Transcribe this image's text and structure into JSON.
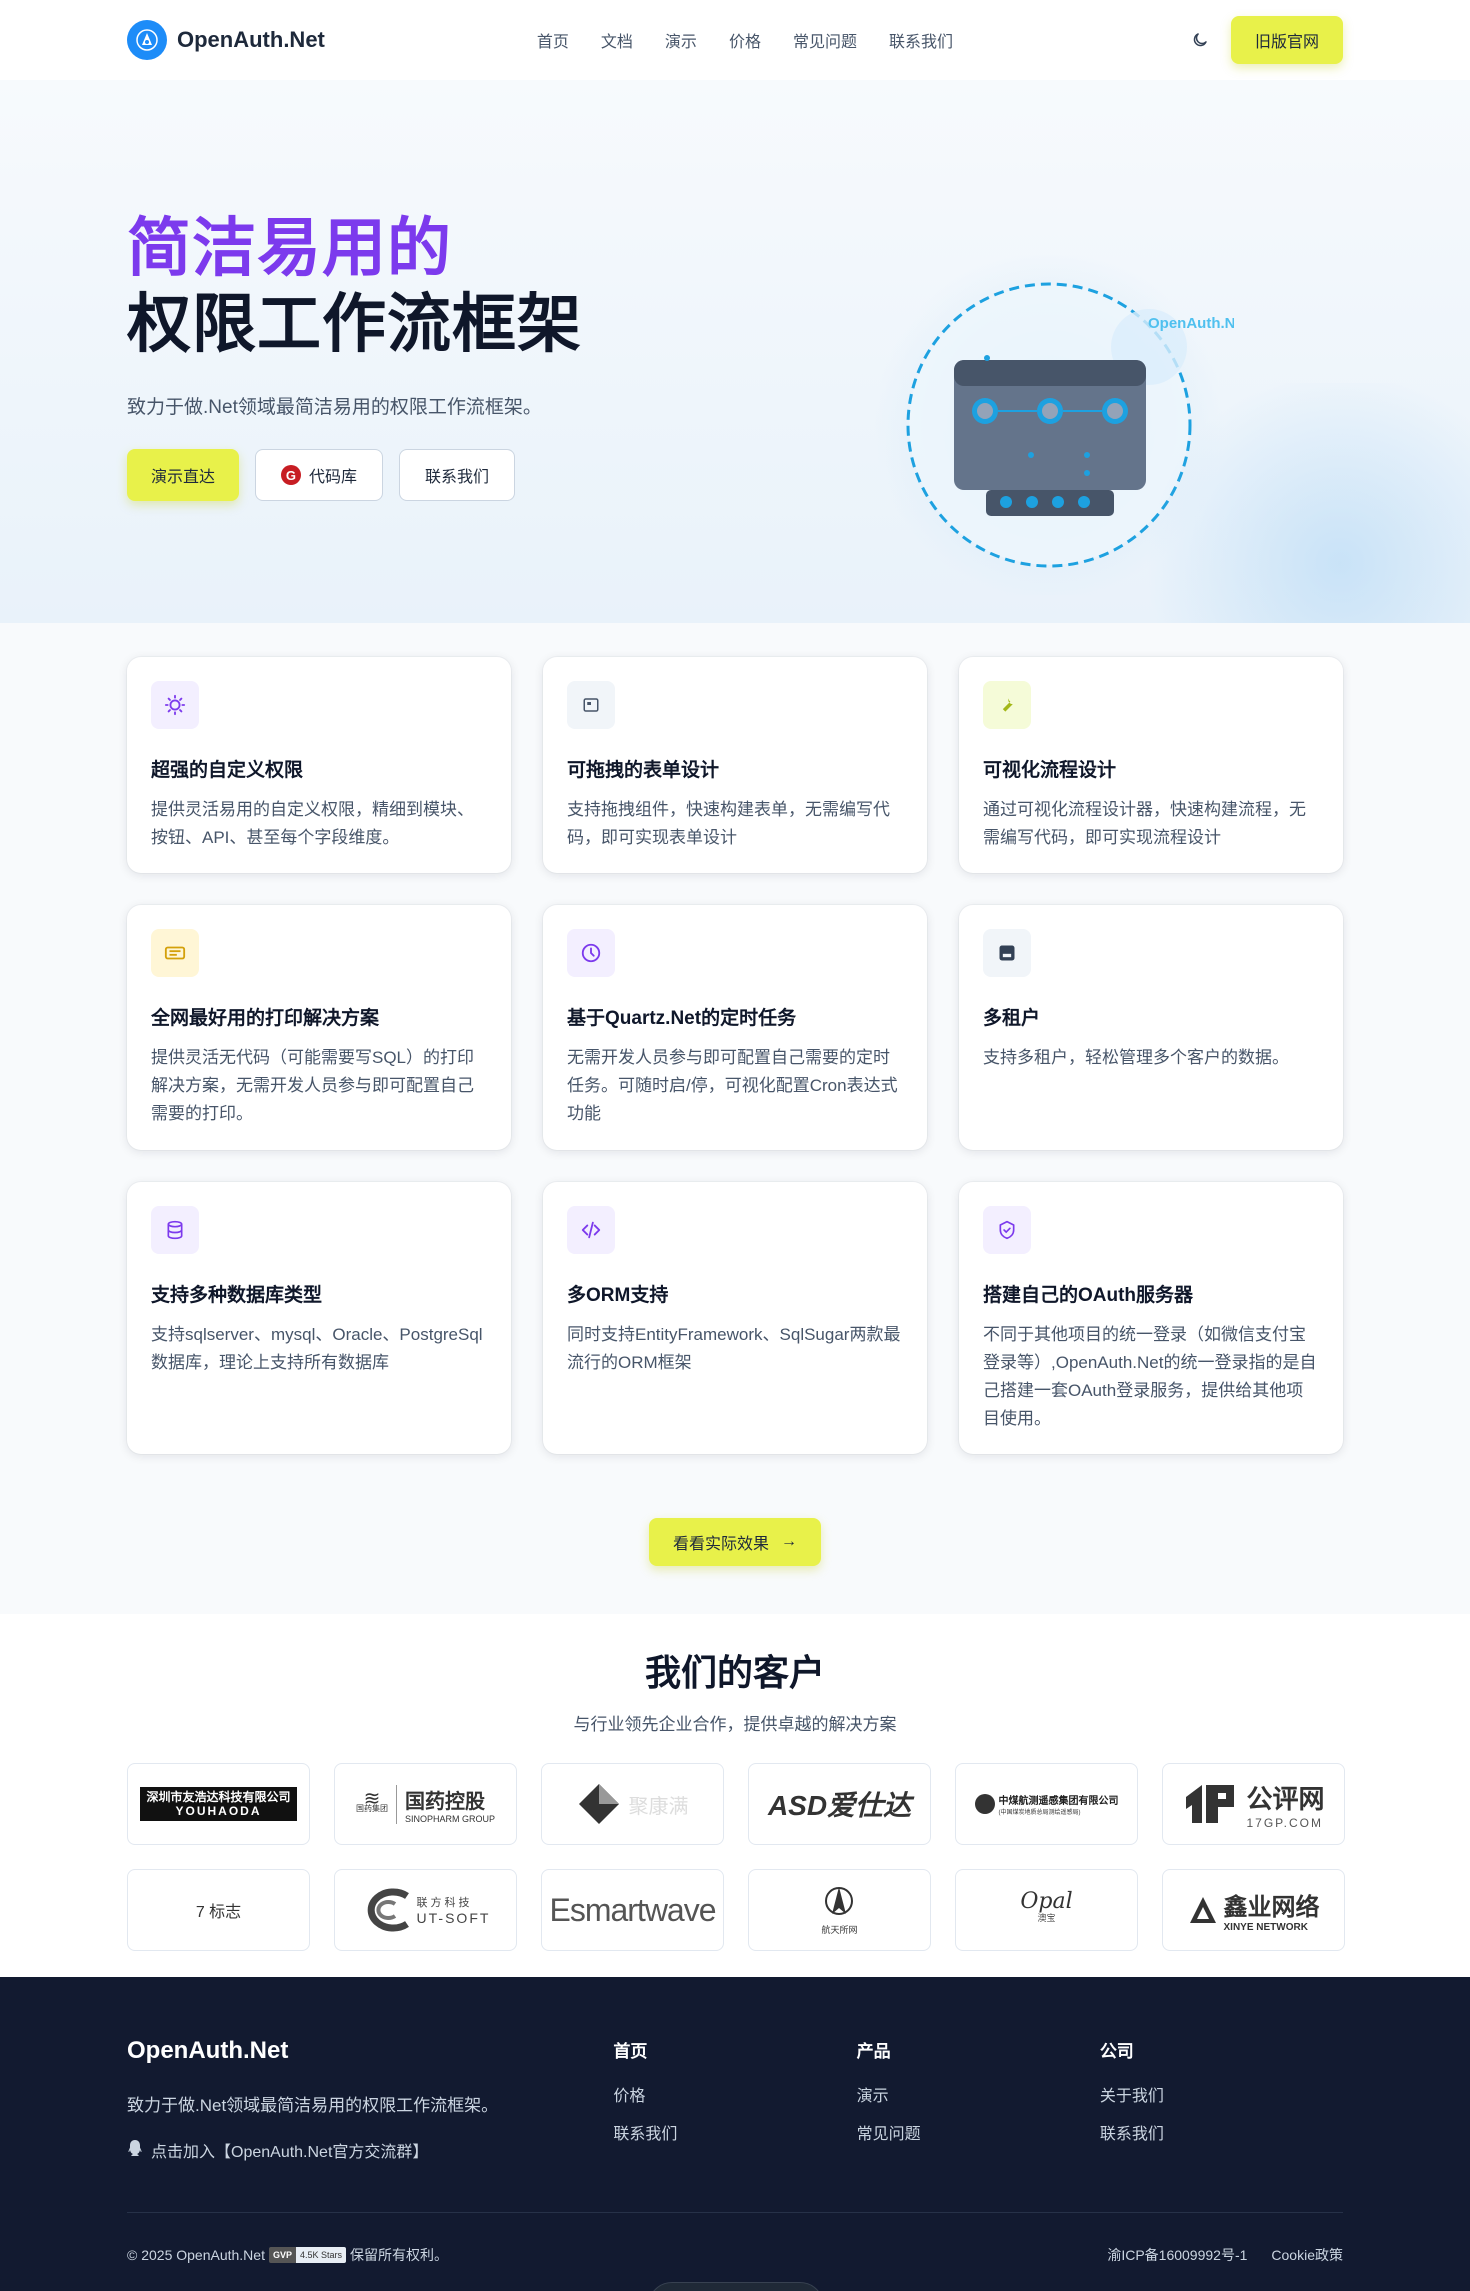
{
  "nav": {
    "brand": "OpenAuth.Net",
    "links": [
      "首页",
      "文档",
      "演示",
      "价格",
      "常见问题",
      "联系我们"
    ],
    "old_site": "旧版官网"
  },
  "hero": {
    "title_highlight": "简洁易用的",
    "title_main": "权限工作流框架",
    "subtitle": "致力于做.Net领域最简洁易用的权限工作流框架。",
    "btn_demo": "演示直达",
    "btn_code": "代码库",
    "btn_contact": "联系我们",
    "art_label": "OpenAuth.Net"
  },
  "features": [
    {
      "icon": "sun-icon",
      "icon_bg": "#f3efff",
      "icon_color": "#7c3aed",
      "title": "超强的自定义权限",
      "desc": "提供灵活易用的自定义权限，精细到模块、按钮、API、甚至每个字段维度。"
    },
    {
      "icon": "form-icon",
      "icon_bg": "#f1f5f9",
      "icon_color": "#475569",
      "title": "可拖拽的表单设计",
      "desc": "支持拖拽组件，快速构建表单，无需编写代码，即可实现表单设计"
    },
    {
      "icon": "wrench-icon",
      "icon_bg": "#f5fbd8",
      "icon_color": "#a3b818",
      "title": "可视化流程设计",
      "desc": "通过可视化流程设计器，快速构建流程，无需编写代码，即可实现流程设计"
    },
    {
      "icon": "ticket-icon",
      "icon_bg": "#fff6d6",
      "icon_color": "#d4a00a",
      "title": "全网最好用的打印解决方案",
      "desc": "提供灵活无代码（可能需要写SQL）的打印解决方案，无需开发人员参与即可配置自己需要的打印。"
    },
    {
      "icon": "clock-icon",
      "icon_bg": "#f3efff",
      "icon_color": "#7c3aed",
      "title": "基于Quartz.Net的定时任务",
      "desc": "无需开发人员参与即可配置自己需要的定时任务。可随时启/停，可视化配置Cron表达式功能"
    },
    {
      "icon": "tenant-icon",
      "icon_bg": "#f1f5f9",
      "icon_color": "#334155",
      "title": "多租户",
      "desc": "支持多租户，轻松管理多个客户的数据。"
    },
    {
      "icon": "database-icon",
      "icon_bg": "#f3efff",
      "icon_color": "#7c3aed",
      "title": "支持多种数据库类型",
      "desc": "支持sqlserver、mysql、Oracle、PostgreSql数据库，理论上支持所有数据库"
    },
    {
      "icon": "code-icon",
      "icon_bg": "#f3efff",
      "icon_color": "#7c3aed",
      "title": "多ORM支持",
      "desc": "同时支持EntityFramework、SqlSugar两款最流行的ORM框架"
    },
    {
      "icon": "shield-check-icon",
      "icon_bg": "#f3efff",
      "icon_color": "#7c3aed",
      "title": "搭建自己的OAuth服务器",
      "desc": "不同于其他项目的统一登录（如微信支付宝登录等）,OpenAuth.Net的统一登录指的是自己搭建一套OAuth登录服务，提供给其他项目使用。"
    }
  ],
  "cta": {
    "label": "看看实际效果",
    "arrow": "→"
  },
  "customers": {
    "title": "我们的客户",
    "subtitle": "与行业领先企业合作，提供卓越的解决方案",
    "logos": [
      {
        "name": "youhaoda",
        "text": "深圳市友浩达科技有限公司",
        "sub": "YOUHAODA"
      },
      {
        "name": "sinopharm",
        "text": "国药控股",
        "sub": "SINOPHARM GROUP",
        "tag": "国药集团"
      },
      {
        "name": "wave",
        "text": "聚康满"
      },
      {
        "name": "asd",
        "text": "ASD爱仕达"
      },
      {
        "name": "coal",
        "text": "中煤航测遥感集团有限公司",
        "sub": "(中国煤炭地质总局测绘遥感局)"
      },
      {
        "name": "17gp",
        "text": "公评网",
        "sub": "17GP.COM"
      },
      {
        "name": "broken",
        "text": "7 标志"
      },
      {
        "name": "utsoft",
        "text": "联方科技",
        "sub": "UT-SOFT"
      },
      {
        "name": "esmartwave",
        "text": "Esmartwave"
      },
      {
        "name": "hangtian",
        "text": "航天所网"
      },
      {
        "name": "opal",
        "text": "Opal",
        "sub": "澳宝"
      },
      {
        "name": "xinye",
        "text": "鑫业网络",
        "sub": "XINYE NETWORK"
      }
    ]
  },
  "footer": {
    "brand": "OpenAuth.Net",
    "desc": "致力于做.Net领域最简洁易用的权限工作流框架。",
    "qq": "点击加入【OpenAuth.Net官方交流群】",
    "cols": [
      {
        "title": "首页",
        "links": [
          "价格",
          "联系我们"
        ]
      },
      {
        "title": "产品",
        "links": [
          "演示",
          "常见问题"
        ]
      },
      {
        "title": "公司",
        "links": [
          "关于我们",
          "联系我们"
        ]
      }
    ],
    "copyright": "© 2025 OpenAuth.Net",
    "badge_left": "GVP",
    "badge_right": "4.5K Stars",
    "rights": "保留所有权利。",
    "icp": "渝ICP备16009992号-1",
    "cookie": "Cookie政策"
  }
}
